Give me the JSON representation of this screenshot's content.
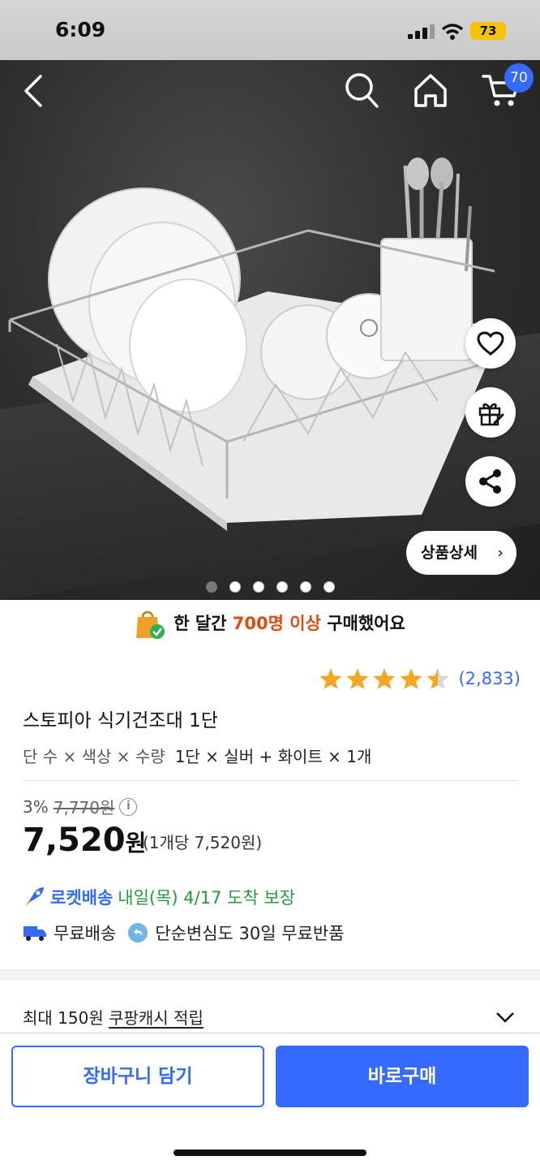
{
  "status_bar": {
    "time": "6:09",
    "battery": "73"
  },
  "nav": {
    "cart_count": "70"
  },
  "hero": {
    "detail_button": "상품상세",
    "carousel": {
      "total": 6,
      "active": 1
    }
  },
  "purchase_banner": {
    "prefix": "한 달간",
    "highlight": "700명 이상",
    "suffix": "구매했어요"
  },
  "rating": {
    "stars": 4.5,
    "count": "(2,833)"
  },
  "product": {
    "title": "스토피아 식기건조대 1단",
    "options_label": "단 수 × 색상 × 수량",
    "options_value": "1단 × 실버 + 화이트 × 1개"
  },
  "price": {
    "discount": "3%",
    "original": "7,770원",
    "final_number": "7,520",
    "final_unit": "원",
    "per_unit": "(1개당 7,520원)"
  },
  "delivery": {
    "rocket_label": "로켓배송",
    "rocket_eta": "내일(목) 4/17 도착 보장",
    "free_shipping": "무료배송",
    "free_return": "단순변심도 30일 무료반품"
  },
  "cashback": {
    "prefix": "최대 150원",
    "link": "쿠팡캐시 적립"
  },
  "actions": {
    "add_to_cart": "장바구니 담기",
    "buy_now": "바로구매"
  },
  "colors": {
    "accent": "#346aff",
    "highlight": "#e24a0d",
    "rocket_green": "#239a3b"
  }
}
